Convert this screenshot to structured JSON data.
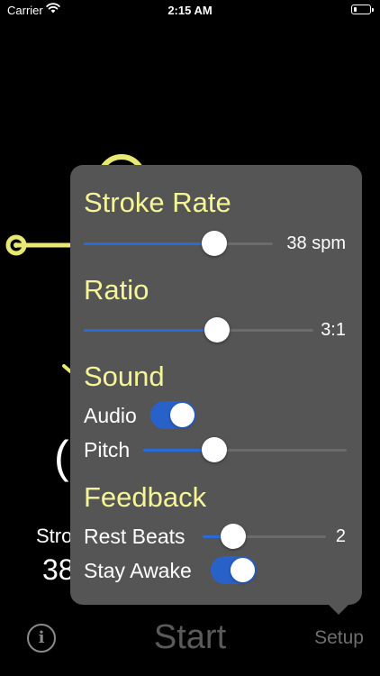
{
  "status_bar": {
    "carrier": "Carrier",
    "time": "2:15 AM",
    "battery_level": 0.2
  },
  "background": {
    "stroke_label_partial": "Stro",
    "stroke_value_partial": "38",
    "accent_color": "#e8e874"
  },
  "toolbar": {
    "info_label": "i",
    "start_label": "Start",
    "setup_label": "Setup"
  },
  "popover": {
    "stroke_rate": {
      "title": "Stroke Rate",
      "value_label": "38 spm",
      "slider_fraction": 0.69
    },
    "ratio": {
      "title": "Ratio",
      "value_label": "3:1",
      "slider_fraction": 0.58
    },
    "sound": {
      "title": "Sound",
      "audio_label": "Audio",
      "audio_on": true,
      "pitch_label": "Pitch",
      "pitch_fraction": 0.35
    },
    "feedback": {
      "title": "Feedback",
      "rest_beats_label": "Rest Beats",
      "rest_beats_value": "2",
      "rest_beats_fraction": 0.25,
      "stay_awake_label": "Stay Awake",
      "stay_awake_on": true
    }
  },
  "colors": {
    "title_yellow": "#f5f597",
    "slider_blue": "#2b6bd8",
    "toggle_blue": "#2862c8",
    "popover_gray": "#555556"
  }
}
